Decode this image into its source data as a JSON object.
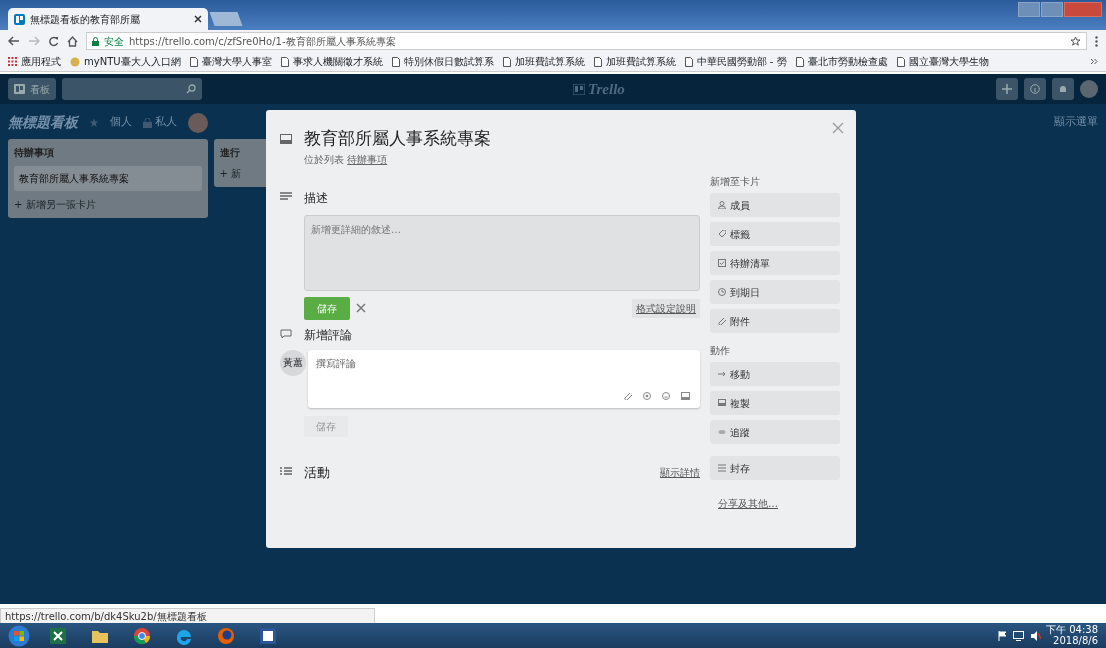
{
  "browser": {
    "tab_title": "無標題看板的教育部所屬",
    "secure_label": "安全",
    "url": "https://trello.com/c/zfSre0Ho/1-教育部所屬人事系統專案",
    "bookmarks": [
      {
        "label": "應用程式",
        "kind": "apps"
      },
      {
        "label": "myNTU臺大人入口網",
        "kind": "site"
      },
      {
        "label": "臺灣大學人事室",
        "kind": "page"
      },
      {
        "label": "事求人機關徵才系統",
        "kind": "page"
      },
      {
        "label": "特別休假日數試算系",
        "kind": "page"
      },
      {
        "label": "加班費試算系統",
        "kind": "page"
      },
      {
        "label": "加班費試算系統",
        "kind": "page"
      },
      {
        "label": "中華民國勞動部 - 勞",
        "kind": "page"
      },
      {
        "label": "臺北市勞動檢查處",
        "kind": "page"
      },
      {
        "label": "國立臺灣大學生物",
        "kind": "page"
      }
    ]
  },
  "trello_header": {
    "boards_button": "看板",
    "logo": "Trello"
  },
  "board": {
    "title": "無標題看板",
    "team": "個人",
    "visibility": "私人",
    "menu": "顯示選單",
    "lists": [
      {
        "title": "待辦事項",
        "cards": [
          "教育部所屬人事系統專案"
        ],
        "add_card": "+ 新增另一張卡片"
      },
      {
        "title": "進行",
        "add_card": "+ 新"
      }
    ]
  },
  "card_modal": {
    "title": "教育部所屬人事系統專案",
    "in_list": "位於列表",
    "list_name": "待辦事項",
    "description": {
      "heading": "描述",
      "placeholder": "新增更詳細的敘述…",
      "save": "儲存",
      "format_help": "格式設定說明"
    },
    "comment": {
      "heading": "新增評論",
      "avatar": "黃蕙",
      "placeholder": "撰寫評論",
      "save": "儲存"
    },
    "activity": {
      "heading": "活動",
      "show_details": "顯示詳情"
    },
    "add_to_card": {
      "heading": "新增至卡片",
      "buttons": [
        {
          "label": "成員"
        },
        {
          "label": "標籤"
        },
        {
          "label": "待辦清單"
        },
        {
          "label": "到期日"
        },
        {
          "label": "附件"
        }
      ]
    },
    "actions": {
      "heading": "動作",
      "buttons": [
        {
          "label": "移動"
        },
        {
          "label": "複製"
        },
        {
          "label": "追蹤"
        },
        {
          "label": "封存"
        }
      ]
    },
    "share": "分享及其他…"
  },
  "status_url": "https://trello.com/b/dk4Sku2b/無標題看板",
  "taskbar": {
    "time": "下午 04:38",
    "date": "2018/8/6"
  }
}
